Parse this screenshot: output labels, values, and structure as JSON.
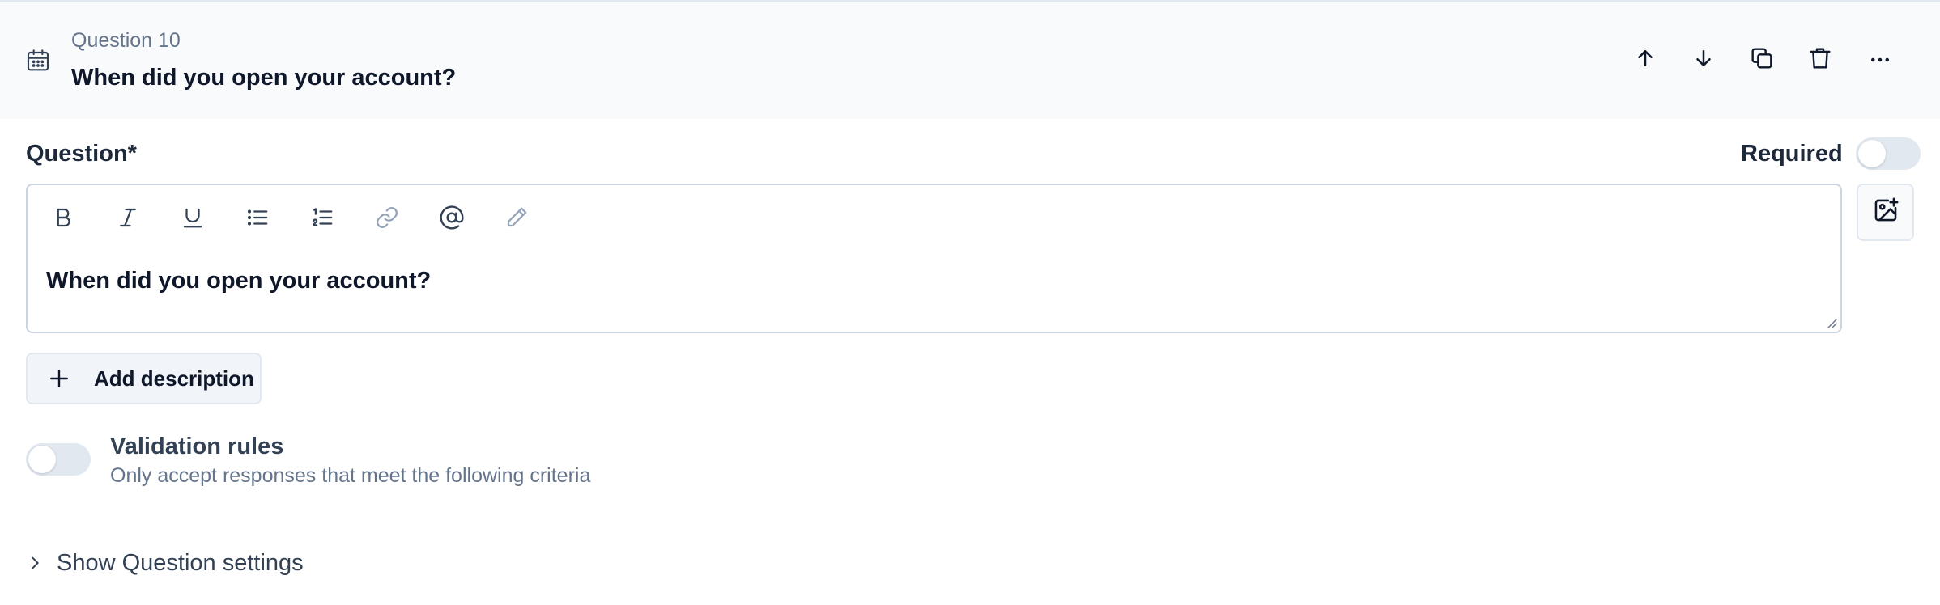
{
  "header": {
    "question_number": "Question 10",
    "question_title": "When did you open your account?",
    "type_icon": "calendar-icon",
    "actions": [
      {
        "name": "move-up-button",
        "icon": "arrow-up-icon"
      },
      {
        "name": "move-down-button",
        "icon": "arrow-down-icon"
      },
      {
        "name": "duplicate-button",
        "icon": "copy-icon"
      },
      {
        "name": "delete-button",
        "icon": "trash-icon"
      },
      {
        "name": "more-options-button",
        "icon": "ellipsis-icon"
      }
    ]
  },
  "question_field": {
    "label": "Question*",
    "required_label": "Required",
    "required_enabled": false,
    "editor_text": "When did you open your account?",
    "toolbar": [
      {
        "name": "bold-button",
        "icon": "bold-icon"
      },
      {
        "name": "italic-button",
        "icon": "italic-icon"
      },
      {
        "name": "underline-button",
        "icon": "underline-icon"
      },
      {
        "name": "bullet-list-button",
        "icon": "bullet-list-icon"
      },
      {
        "name": "numbered-list-button",
        "icon": "numbered-list-icon"
      },
      {
        "name": "link-button",
        "icon": "link-icon"
      },
      {
        "name": "mention-button",
        "icon": "at-sign-icon"
      },
      {
        "name": "highlight-button",
        "icon": "pencil-icon"
      }
    ],
    "image_button_icon": "image-add-icon"
  },
  "add_description": {
    "label": "Add description",
    "icon": "plus-icon"
  },
  "validation": {
    "title": "Validation rules",
    "description": "Only accept responses that meet the following criteria",
    "enabled": false
  },
  "settings": {
    "label": "Show Question settings",
    "icon": "chevron-right-icon"
  },
  "colors": {
    "header_bg": "#f8fafc",
    "text_primary": "#0f172a",
    "text_muted": "#64748b",
    "border": "#cbd5e1",
    "toggle_off": "#e2e8f0"
  }
}
